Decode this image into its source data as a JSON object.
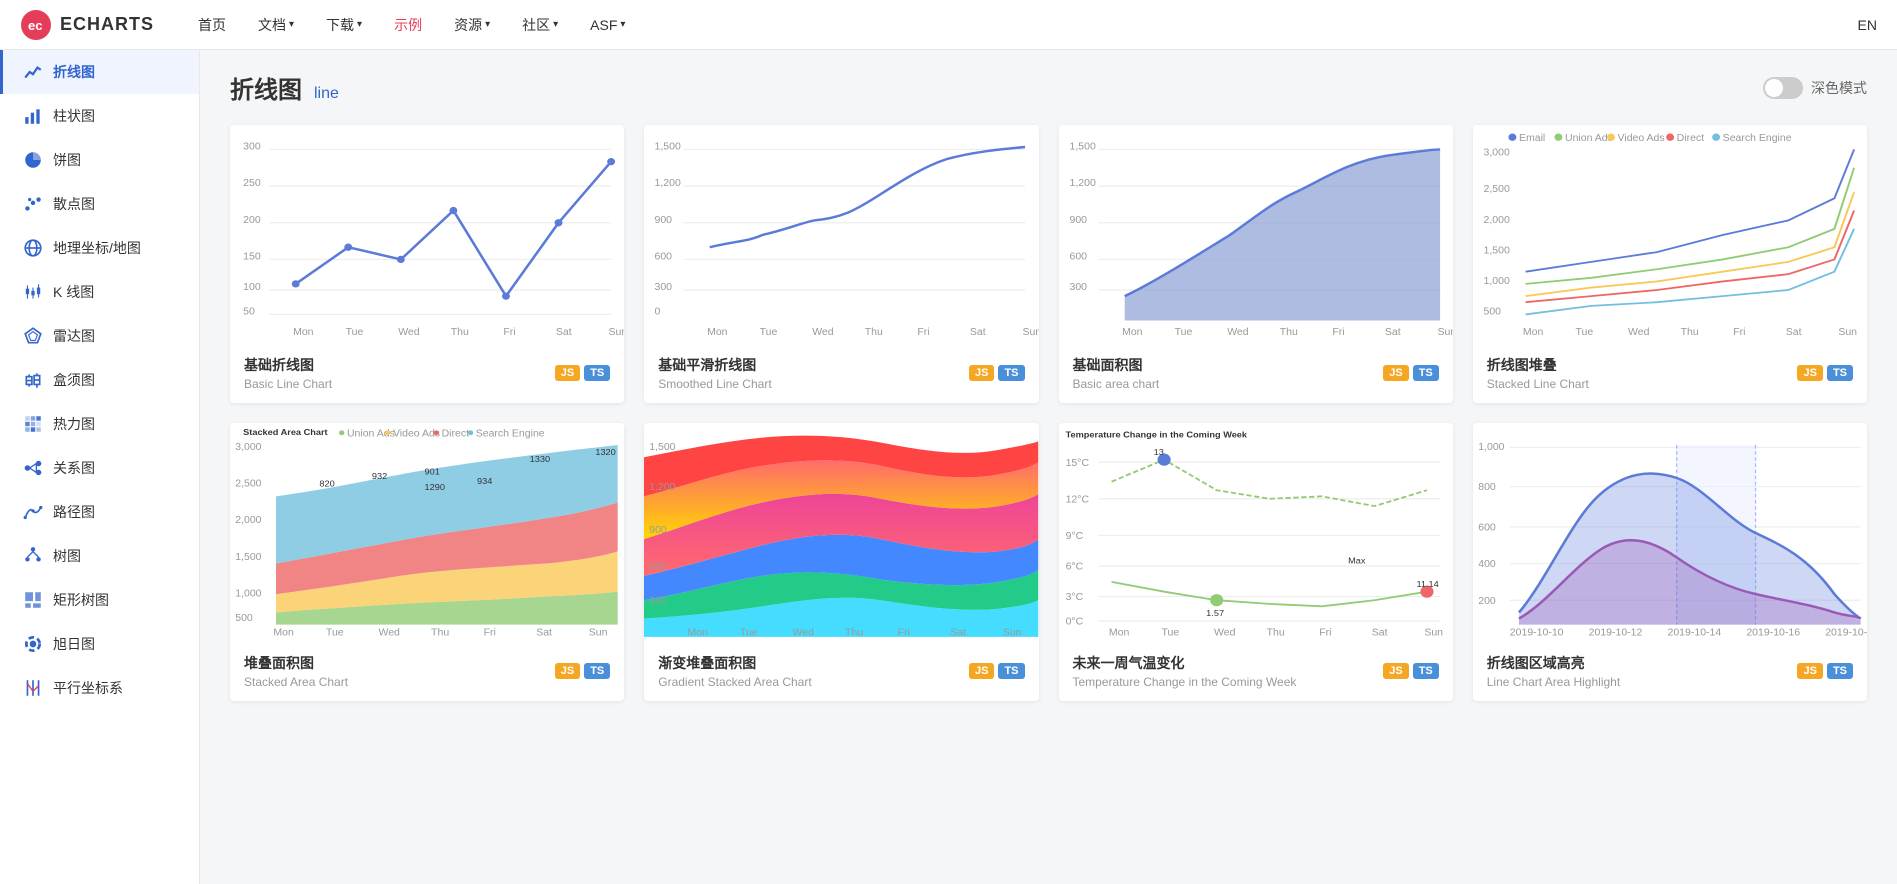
{
  "header": {
    "logo_text": "ECHARTS",
    "nav_items": [
      {
        "label": "首页",
        "active": false,
        "has_dropdown": false
      },
      {
        "label": "文档",
        "active": false,
        "has_dropdown": true
      },
      {
        "label": "下载",
        "active": false,
        "has_dropdown": true
      },
      {
        "label": "示例",
        "active": true,
        "has_dropdown": false
      },
      {
        "label": "资源",
        "active": false,
        "has_dropdown": true
      },
      {
        "label": "社区",
        "active": false,
        "has_dropdown": true
      },
      {
        "label": "ASF",
        "active": false,
        "has_dropdown": true
      }
    ],
    "lang_switch": "EN"
  },
  "sidebar": {
    "items": [
      {
        "label": "折线图",
        "icon": "📈",
        "active": true
      },
      {
        "label": "柱状图",
        "icon": "📊",
        "active": false
      },
      {
        "label": "饼图",
        "icon": "🥧",
        "active": false
      },
      {
        "label": "散点图",
        "icon": "✦",
        "active": false
      },
      {
        "label": "地理坐标/地图",
        "icon": "🗺",
        "active": false
      },
      {
        "label": "K 线图",
        "icon": "📶",
        "active": false
      },
      {
        "label": "雷达图",
        "icon": "⬡",
        "active": false
      },
      {
        "label": "盒须图",
        "icon": "⊞",
        "active": false
      },
      {
        "label": "热力图",
        "icon": "⊞",
        "active": false
      },
      {
        "label": "关系图",
        "icon": "✳",
        "active": false
      },
      {
        "label": "路径图",
        "icon": "〜",
        "active": false
      },
      {
        "label": "树图",
        "icon": "⊤",
        "active": false
      },
      {
        "label": "矩形树图",
        "icon": "⊞",
        "active": false
      },
      {
        "label": "旭日图",
        "icon": "⚙",
        "active": false
      },
      {
        "label": "平行坐标系",
        "icon": "≡",
        "active": false
      }
    ]
  },
  "page": {
    "title_zh": "折线图",
    "title_en": "line",
    "dark_mode_label": "深色模式"
  },
  "charts": [
    {
      "id": "basic-line",
      "title_zh": "基础折线图",
      "title_en": "Basic Line Chart",
      "has_js": true,
      "has_ts": true,
      "type": "basic_line"
    },
    {
      "id": "smooth-line",
      "title_zh": "基础平滑折线图",
      "title_en": "Smoothed Line Chart",
      "has_js": true,
      "has_ts": true,
      "type": "smooth_line"
    },
    {
      "id": "basic-area",
      "title_zh": "基础面积图",
      "title_en": "Basic area chart",
      "has_js": true,
      "has_ts": true,
      "type": "basic_area"
    },
    {
      "id": "stacked-line",
      "title_zh": "折线图堆叠",
      "title_en": "Stacked Line Chart",
      "has_js": true,
      "has_ts": true,
      "type": "stacked_lines"
    },
    {
      "id": "stacked-area",
      "title_zh": "堆叠面积图",
      "title_en": "Stacked Area Chart",
      "has_js": true,
      "has_ts": true,
      "type": "stacked_area"
    },
    {
      "id": "gradient-stacked-area",
      "title_zh": "渐变堆叠面积图",
      "title_en": "Gradient Stacked Area Chart",
      "has_js": true,
      "has_ts": true,
      "type": "gradient_stacked"
    },
    {
      "id": "temp-change",
      "title_zh": "未来一周气温变化",
      "title_en": "Temperature Change in the Coming Week",
      "has_js": true,
      "has_ts": true,
      "type": "temp_change"
    },
    {
      "id": "area-highlight",
      "title_zh": "折线图区域高亮",
      "title_en": "Line Chart Area Highlight",
      "has_js": true,
      "has_ts": true,
      "type": "area_highlight"
    }
  ],
  "labels": {
    "js": "JS",
    "ts": "TS",
    "days": [
      "Mon",
      "Tue",
      "Wed",
      "Thu",
      "Fri",
      "Sat",
      "Sun"
    ]
  }
}
